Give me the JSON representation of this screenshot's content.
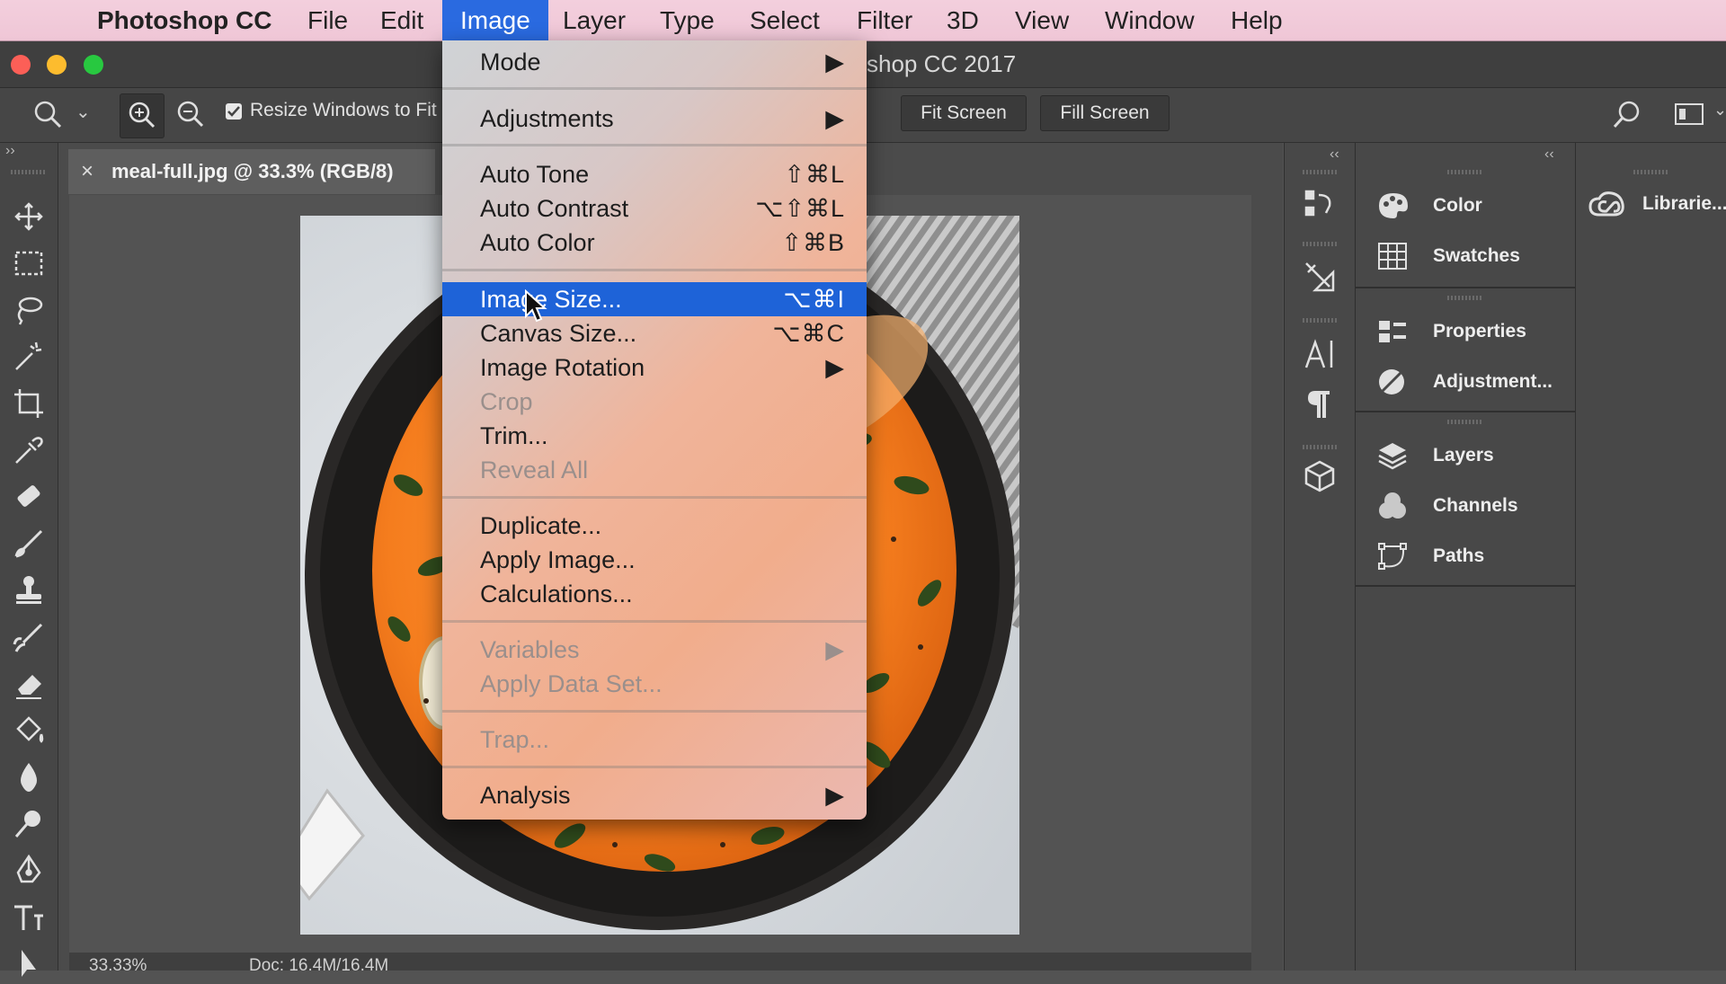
{
  "menubar": {
    "app_name": "Photoshop CC",
    "items": [
      "File",
      "Edit",
      "Image",
      "Layer",
      "Type",
      "Select",
      "Filter",
      "3D",
      "View",
      "Window",
      "Help"
    ],
    "active": "Image"
  },
  "window": {
    "title_partial": "shop CC 2017"
  },
  "options_bar": {
    "resize_label": "Resize Windows to Fit",
    "fit_screen": "Fit Screen",
    "fill_screen": "Fill Screen"
  },
  "document": {
    "tab_label": "meal-full.jpg @ 33.3% (RGB/8)",
    "zoom": "33.33%",
    "doc_info": "Doc: 16.4M/16.4M"
  },
  "image_menu": {
    "mode": "Mode",
    "adjustments": "Adjustments",
    "auto_tone": "Auto Tone",
    "auto_tone_key": "⇧⌘L",
    "auto_contrast": "Auto Contrast",
    "auto_contrast_key": "⌥⇧⌘L",
    "auto_color": "Auto Color",
    "auto_color_key": "⇧⌘B",
    "image_size": "Image Size...",
    "image_size_key": "⌥⌘I",
    "canvas_size": "Canvas Size...",
    "canvas_size_key": "⌥⌘C",
    "image_rotation": "Image Rotation",
    "crop": "Crop",
    "trim": "Trim...",
    "reveal_all": "Reveal All",
    "duplicate": "Duplicate...",
    "apply_image": "Apply Image...",
    "calculations": "Calculations...",
    "variables": "Variables",
    "apply_data_set": "Apply Data Set...",
    "trap": "Trap...",
    "analysis": "Analysis",
    "submenu_arrow": "▶"
  },
  "panels": {
    "color": "Color",
    "swatches": "Swatches",
    "properties": "Properties",
    "adjustments": "Adjustment...",
    "layers": "Layers",
    "channels": "Channels",
    "paths": "Paths",
    "libraries": "Librarie..."
  },
  "glyphs": {
    "apple": "",
    "close_tab": "×",
    "collapse": "‹‹",
    "expand": "››",
    "chevron": "⌄"
  },
  "colors": {
    "menu_highlight": "#1e63d8",
    "menubar_bg": "#efc6d6",
    "app_bg": "#535353"
  }
}
